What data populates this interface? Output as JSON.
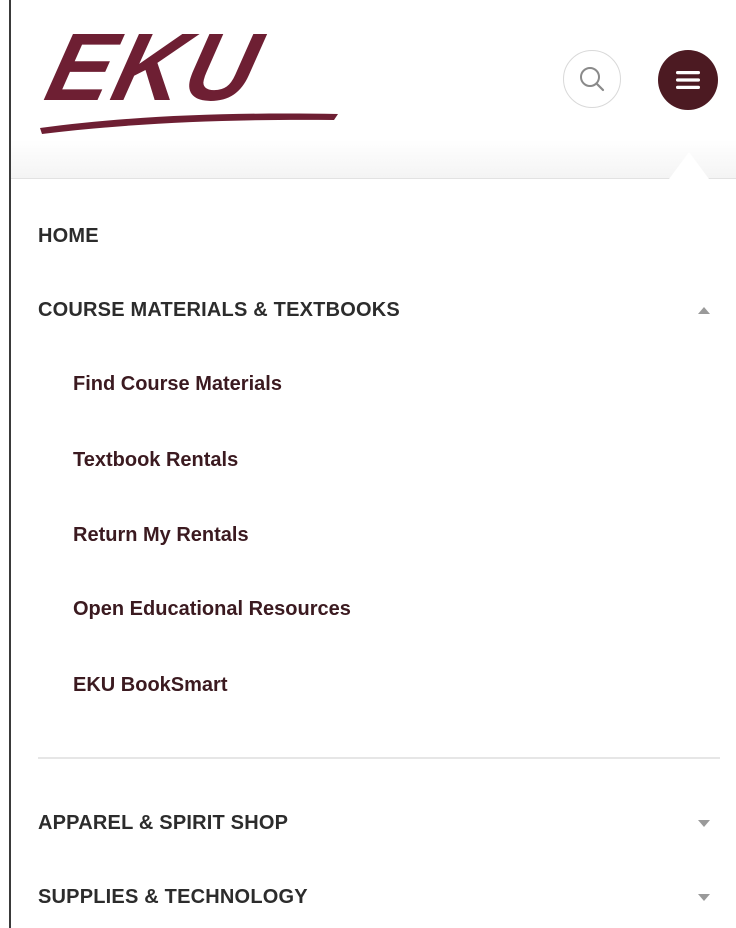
{
  "brand": {
    "logo_text": "EKU",
    "colors": {
      "maroon": "#6e1f33",
      "menu_button": "#4c1a22",
      "text": "#2c2c2c"
    }
  },
  "header": {
    "search_icon": "search-icon",
    "menu_icon": "hamburger-icon"
  },
  "nav": {
    "home": "HOME",
    "course_materials": {
      "label": "COURSE MATERIALS & TEXTBOOKS",
      "expanded": true,
      "toggle_icon": "chevron-up-icon",
      "children": [
        "Find Course Materials",
        "Textbook Rentals",
        "Return My Rentals",
        "Open Educational Resources",
        "EKU BookSmart"
      ]
    },
    "apparel": {
      "label": "APPAREL & SPIRIT SHOP",
      "expanded": false,
      "toggle_icon": "chevron-down-icon"
    },
    "supplies": {
      "label": "SUPPLIES & TECHNOLOGY",
      "expanded": false,
      "toggle_icon": "chevron-down-icon"
    }
  }
}
